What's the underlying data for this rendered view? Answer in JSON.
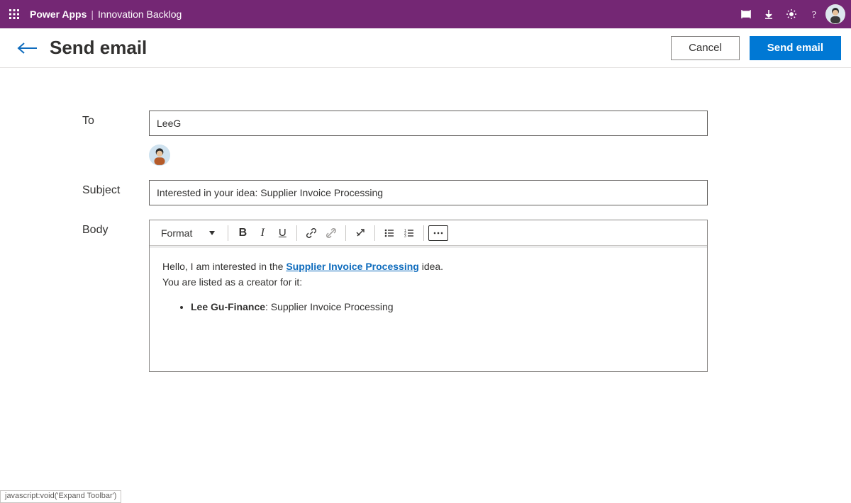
{
  "topbar": {
    "brand": "Power Apps",
    "separator": "|",
    "appTitle": "Innovation Backlog"
  },
  "pageHead": {
    "title": "Send email",
    "cancelLabel": "Cancel",
    "sendLabel": "Send email"
  },
  "form": {
    "toLabel": "To",
    "toValue": "LeeG",
    "subjectLabel": "Subject",
    "subjectValue": "Interested in your idea: Supplier Invoice Processing",
    "bodyLabel": "Body"
  },
  "rte": {
    "formatLabel": "Format",
    "body": {
      "line1_pre": "Hello, I am interested in the ",
      "line1_link": "Supplier Invoice Processing",
      "line1_post": " idea.",
      "line2": "You are listed as a creator for it:",
      "bullet_strong": "Lee Gu-Finance",
      "bullet_rest": ": Supplier Invoice Processing"
    }
  },
  "status": "javascript:void('Expand Toolbar')"
}
